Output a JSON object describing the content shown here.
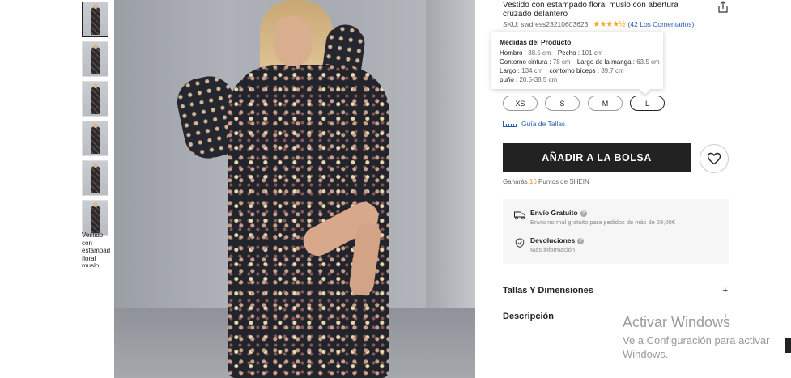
{
  "product": {
    "title": "Vestido con estampado floral muslo con abertura cruzado delantero",
    "sku_label": "SKU: swdress23210603623",
    "stars": "★★★★½",
    "reviews": "(42 Los Comentarios)",
    "thumb_caption": "Vestido con estampado floral muslo"
  },
  "measurements": {
    "title": "Medidas del Producto",
    "rows": [
      [
        {
          "label": "Hombro : ",
          "value": "38.5 cm"
        },
        {
          "label": "Pecho : ",
          "value": "101 cm"
        }
      ],
      [
        {
          "label": "Contorno cintura : ",
          "value": "78 cm"
        },
        {
          "label": "Largo de la manga : ",
          "value": "63.5 cm"
        }
      ],
      [
        {
          "label": "Largo : ",
          "value": "134 cm"
        },
        {
          "label": "contorno bíceps : ",
          "value": "39.7 cm"
        }
      ],
      [
        {
          "label": "puño : ",
          "value": "20.5-38.5 cm"
        }
      ]
    ]
  },
  "sizes": {
    "options": [
      "XS",
      "S",
      "M",
      "L"
    ],
    "selected": "L",
    "guide_label": "Guía de Tallas"
  },
  "actions": {
    "add_to_bag": "AÑADIR A LA BOLSA"
  },
  "points": {
    "prefix": "Ganarás ",
    "value": "16",
    "suffix": " Puntos de SHEIN"
  },
  "shipping": {
    "free_title": "Envío Gratuito",
    "free_desc": "Envío normal gratuito para pedidos de más de 29,00€",
    "returns_title": "Devoluciones",
    "returns_desc": "Más información"
  },
  "sections": {
    "sizes_title": "Tallas Y Dimensiones",
    "description_title": "Descripción",
    "expand_symbol": "+"
  },
  "watermark": {
    "line1": "Activar Windows",
    "line2": "Ve a Configuración para activar",
    "line3": "Windows."
  }
}
